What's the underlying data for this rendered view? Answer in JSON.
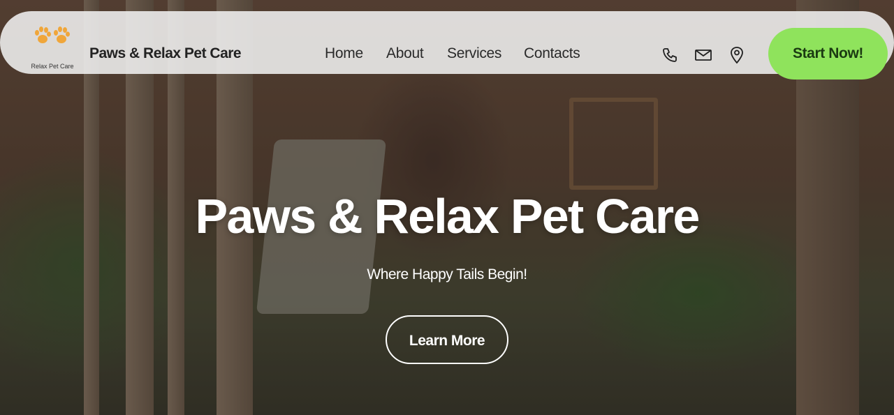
{
  "header": {
    "logo_text": "Relax Pet Care",
    "brand": "Paws & Relax Pet Care",
    "nav": [
      {
        "label": "Home"
      },
      {
        "label": "About"
      },
      {
        "label": "Services"
      },
      {
        "label": "Contacts"
      }
    ],
    "icons": [
      "phone-icon",
      "mail-icon",
      "location-pin-icon"
    ],
    "cta_label": "Start Now!"
  },
  "hero": {
    "title": "Paws & Relax Pet Care",
    "subtitle": "Where Happy Tails Begin!",
    "button_label": "Learn More"
  },
  "colors": {
    "accent": "#8fe35c",
    "logo_paw": "#f0a63a",
    "nav_bg": "#f0f0f0",
    "text_dark": "#222222",
    "hero_text": "#ffffff"
  }
}
